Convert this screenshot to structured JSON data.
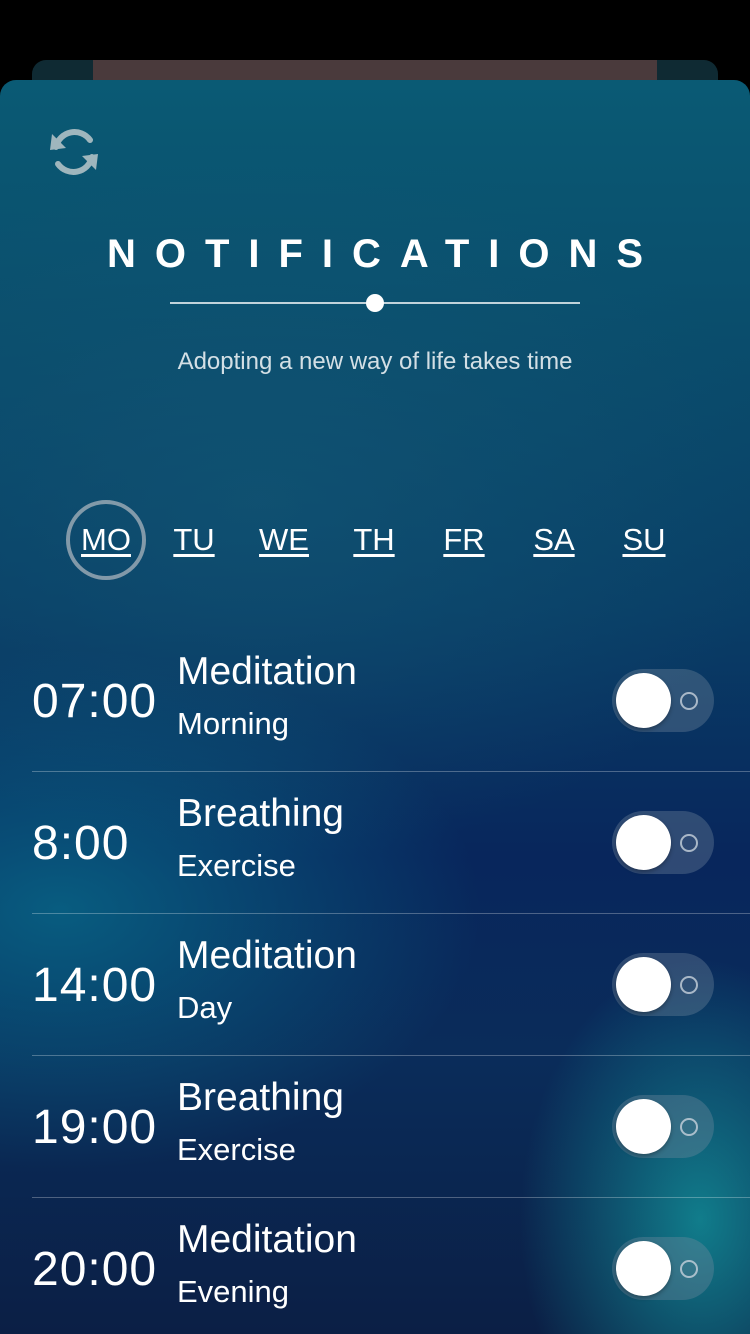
{
  "header": {
    "title": "NOTIFICATIONS",
    "subtitle": "Adopting a new way of life takes time"
  },
  "icons": {
    "refresh": "refresh-icon"
  },
  "days": [
    {
      "label": "MO",
      "selected": true
    },
    {
      "label": "TU",
      "selected": false
    },
    {
      "label": "WE",
      "selected": false
    },
    {
      "label": "TH",
      "selected": false
    },
    {
      "label": "FR",
      "selected": false
    },
    {
      "label": "SA",
      "selected": false
    },
    {
      "label": "SU",
      "selected": false
    }
  ],
  "notifications": [
    {
      "time": "07:00",
      "title": "Meditation",
      "subtitle": "Morning",
      "enabled": false
    },
    {
      "time": "8:00",
      "title": "Breathing",
      "subtitle": "Exercise",
      "enabled": false
    },
    {
      "time": "14:00",
      "title": "Meditation",
      "subtitle": "Day",
      "enabled": false
    },
    {
      "time": "19:00",
      "title": "Breathing",
      "subtitle": "Exercise",
      "enabled": false
    },
    {
      "time": "20:00",
      "title": "Meditation",
      "subtitle": "Evening",
      "enabled": false
    }
  ],
  "colors": {
    "accent": "#ffffff",
    "background_top": "#0a5a74",
    "background_bottom": "#0b1f45"
  }
}
